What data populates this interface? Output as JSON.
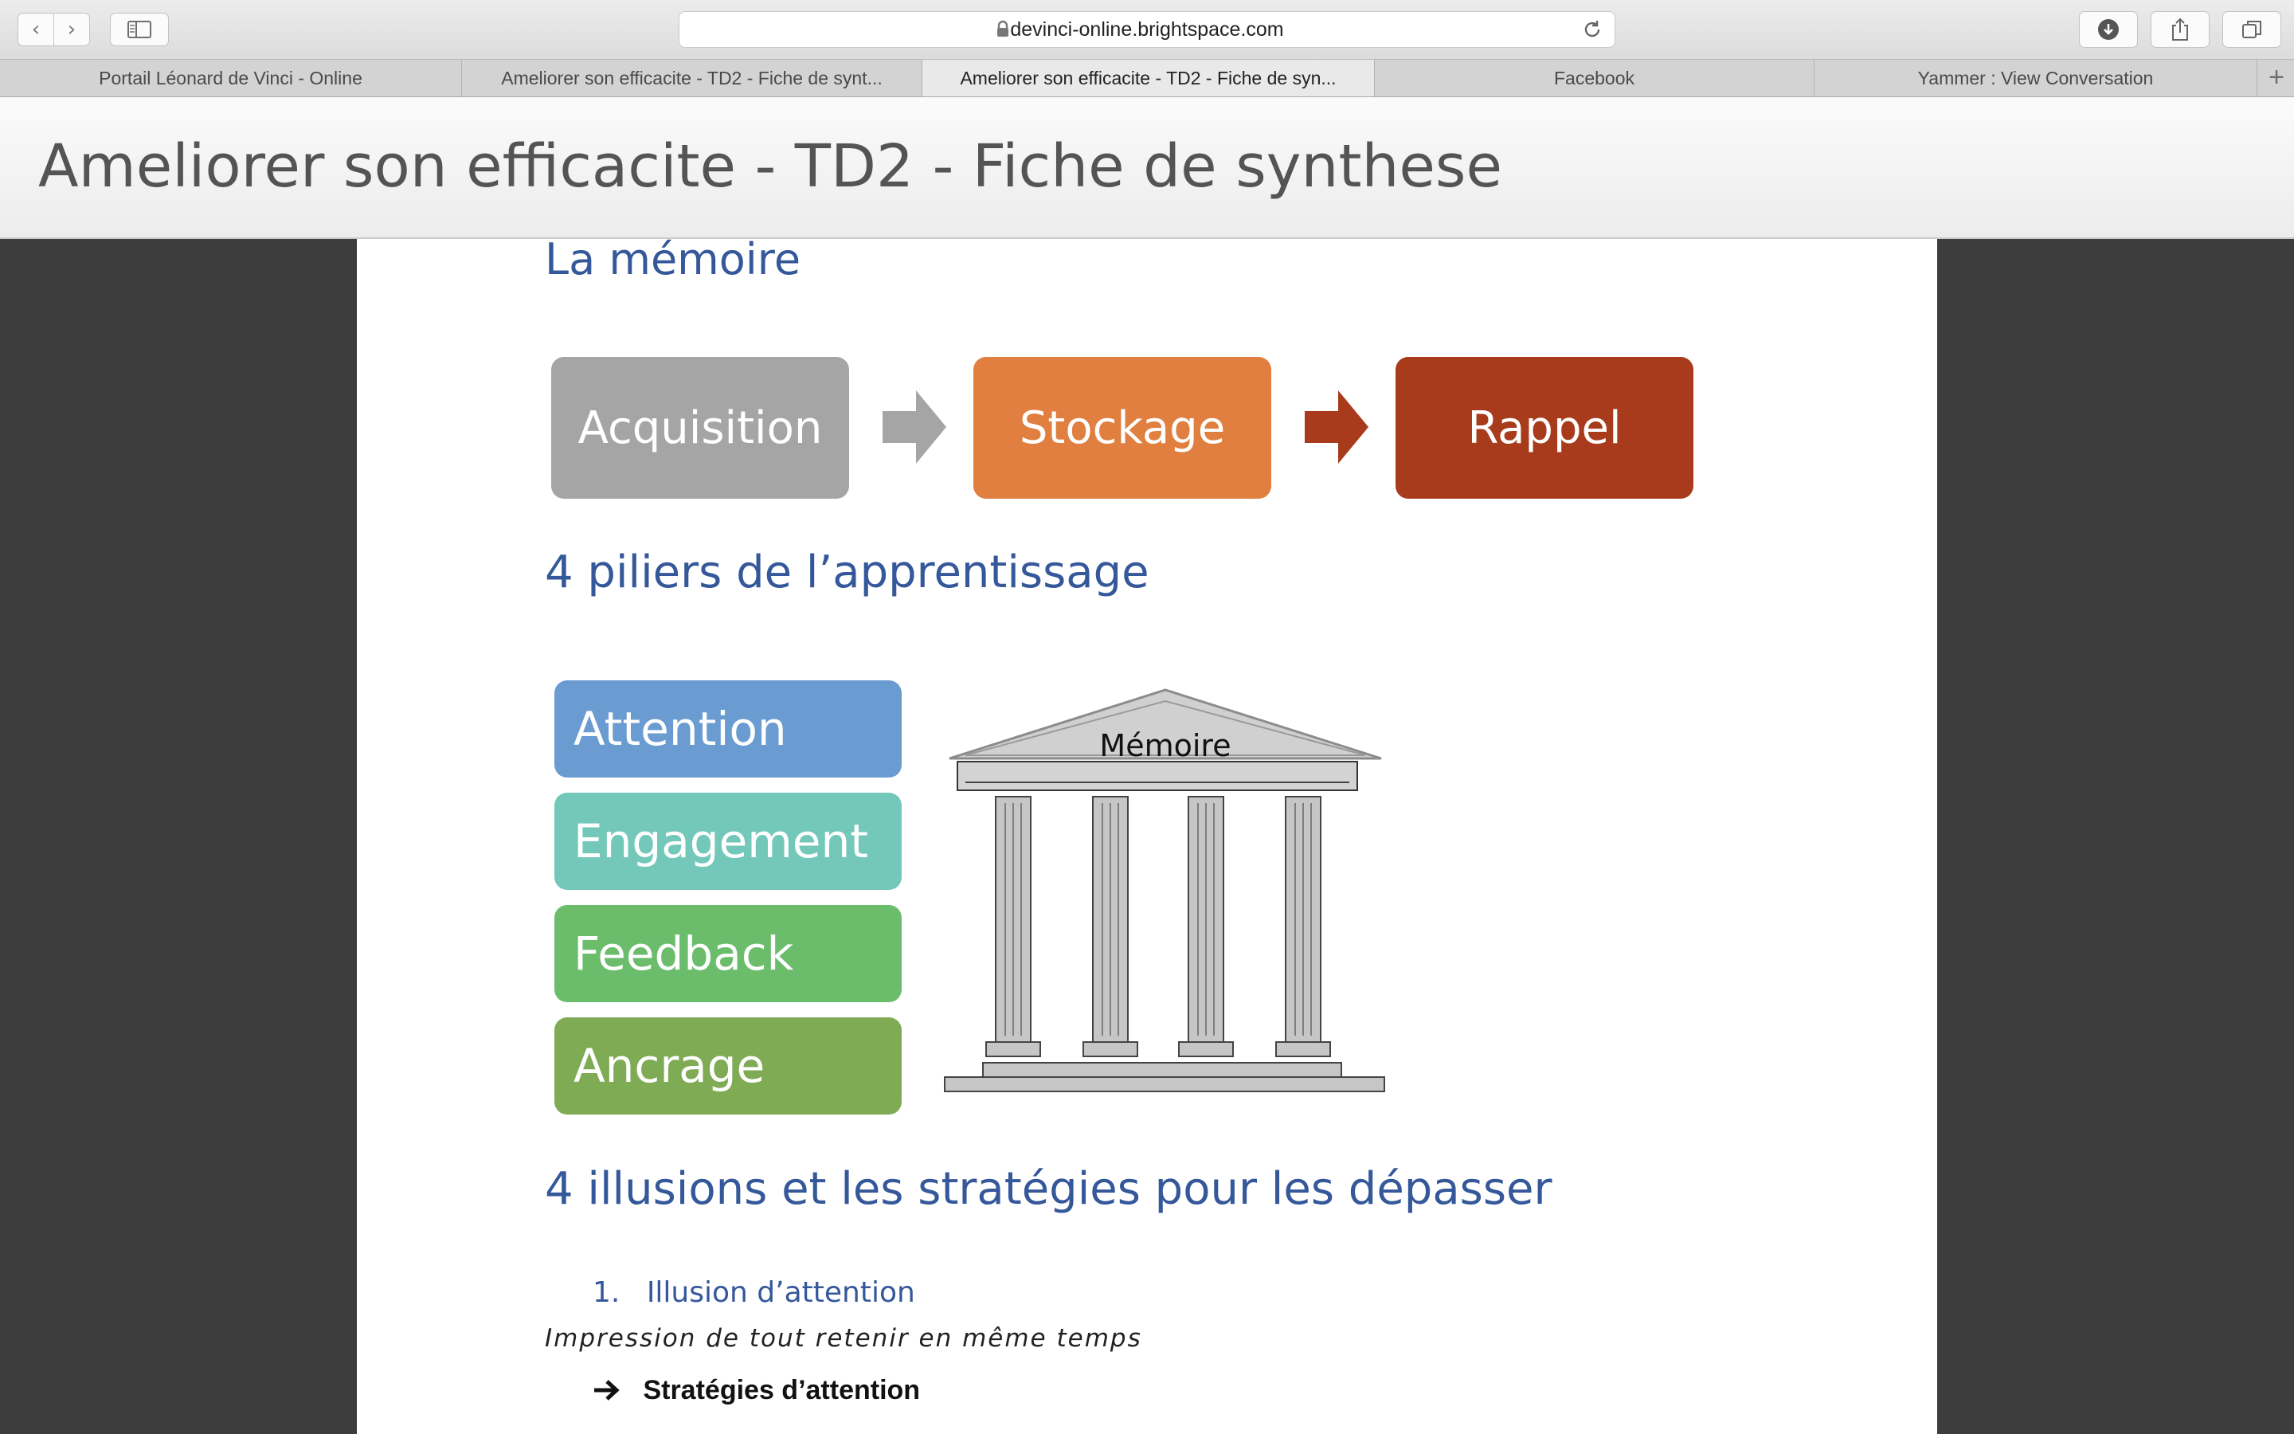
{
  "browser": {
    "url": "devinci-online.brightspace.com",
    "tabs": [
      {
        "label": "Portail Léonard de Vinci - Online",
        "active": false
      },
      {
        "label": "Ameliorer son efficacite - TD2 - Fiche de synt...",
        "active": false
      },
      {
        "label": "Ameliorer son efficacite - TD2 - Fiche de syn...",
        "active": true
      },
      {
        "label": "Facebook",
        "active": false
      },
      {
        "label": "Yammer : View Conversation",
        "active": false
      }
    ],
    "add_tab": "+"
  },
  "header": {
    "title": "Ameliorer son efficacite - TD2 - Fiche de synthese"
  },
  "document": {
    "memoire_heading": "La mémoire",
    "flow": [
      {
        "label": "Acquisition",
        "color": "#a5a5a5"
      },
      {
        "label": "Stockage",
        "color": "#e07f3f"
      },
      {
        "label": "Rappel",
        "color": "#a83b1b"
      }
    ],
    "piliers_heading": "4 piliers de l’apprentissage",
    "pillars": [
      {
        "label": "Attention",
        "color": "#6a9bd1"
      },
      {
        "label": "Engagement",
        "color": "#74c8b9"
      },
      {
        "label": "Feedback",
        "color": "#6bbd6c"
      },
      {
        "label": "Ancrage",
        "color": "#7fab55"
      }
    ],
    "temple_label": "Mémoire",
    "illusions_heading": "4 illusions et les stratégies pour les dépasser",
    "list_item_number": "1.",
    "list_item": "Illusion d’attention",
    "note": "Impression de tout retenir en même temps",
    "strategy": "Stratégies d’attention"
  },
  "icons": {
    "back": "chevron-left-icon",
    "forward": "chevron-right-icon",
    "sidebar": "sidebar-icon",
    "lock": "lock-icon",
    "reload": "reload-icon",
    "download": "download-icon",
    "share": "share-icon",
    "tabs": "tabs-overview-icon",
    "bullet": "right-arrow-icon"
  },
  "colors": {
    "heading_blue": "#35589a",
    "canvas": "#3d3d3d"
  }
}
